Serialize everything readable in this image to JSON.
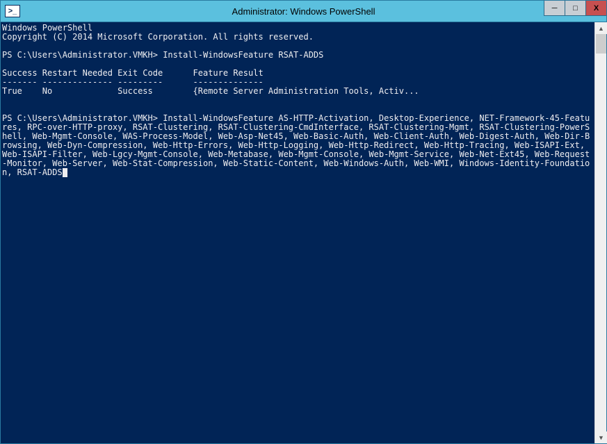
{
  "window": {
    "title": "Administrator: Windows PowerShell",
    "icon_label": ">_"
  },
  "controls": {
    "minimize": "─",
    "maximize": "□",
    "close": "X"
  },
  "console": {
    "line1": "Windows PowerShell",
    "line2": "Copyright (C) 2014 Microsoft Corporation. All rights reserved.",
    "blank1": " ",
    "prompt1": "PS C:\\Users\\Administrator.VMKH> Install-WindowsFeature RSAT-ADDS",
    "blank2": " ",
    "header": "Success Restart Needed Exit Code      Feature Result",
    "divider": "------- -------------- ---------      --------------",
    "result": "True    No             Success        {Remote Server Administration Tools, Activ...",
    "blank3": " ",
    "blank4": " ",
    "cmd": "PS C:\\Users\\Administrator.VMKH> Install-WindowsFeature AS-HTTP-Activation, Desktop-Experience, NET-Framework-45-Features, RPC-over-HTTP-proxy, RSAT-Clustering, RSAT-Clustering-CmdInterface, RSAT-Clustering-Mgmt, RSAT-Clustering-PowerShell, Web-Mgmt-Console, WAS-Process-Model, Web-Asp-Net45, Web-Basic-Auth, Web-Client-Auth, Web-Digest-Auth, Web-Dir-Browsing, Web-Dyn-Compression, Web-Http-Errors, Web-Http-Logging, Web-Http-Redirect, Web-Http-Tracing, Web-ISAPI-Ext, Web-ISAPI-Filter, Web-Lgcy-Mgmt-Console, Web-Metabase, Web-Mgmt-Console, Web-Mgmt-Service, Web-Net-Ext45, Web-Request-Monitor, Web-Server, Web-Stat-Compression, Web-Static-Content, Web-Windows-Auth, Web-WMI, Windows-Identity-Foundation, RSAT-ADDS"
  }
}
